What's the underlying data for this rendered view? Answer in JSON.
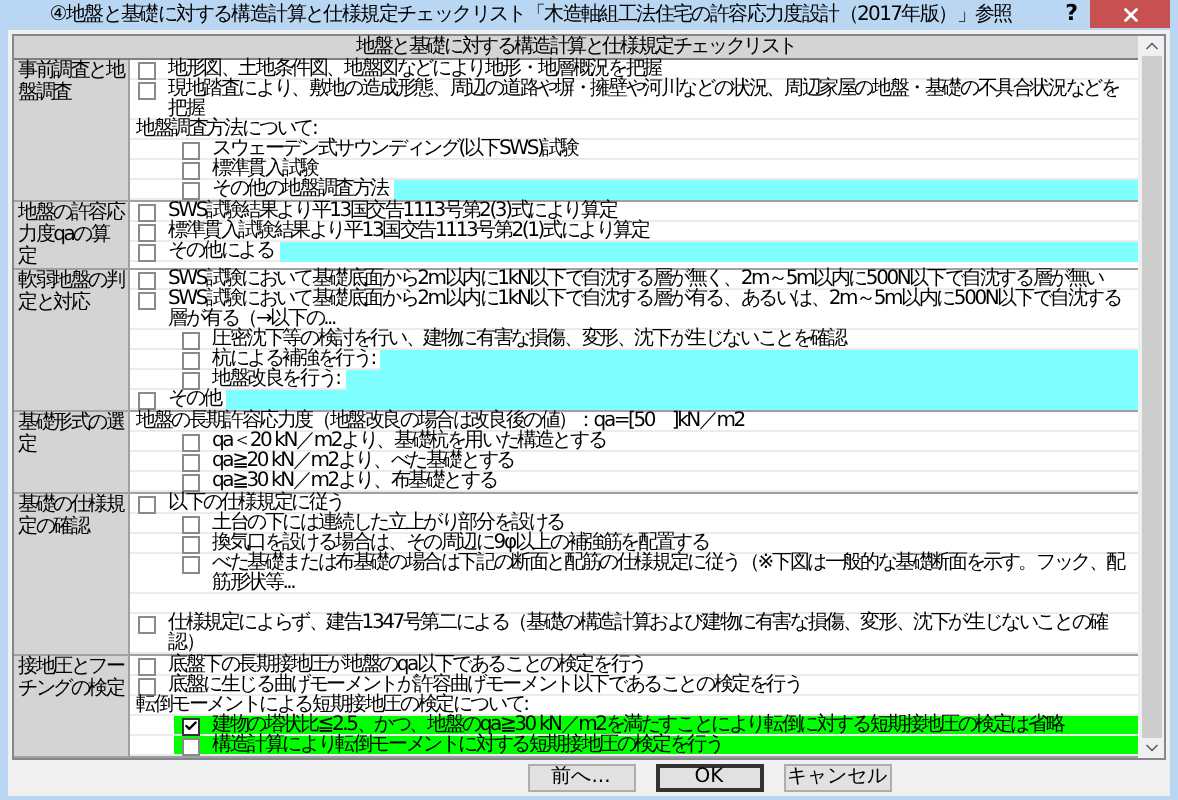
{
  "window": {
    "title": "④地盤と基礎に対する構造計算と仕様規定チェックリスト「木造軸組工法住宅の許容応力度設計（2017年版）」参照",
    "help": "?"
  },
  "checklist": {
    "heading": "地盤と基礎に対する構造計算と仕様規定チェックリスト",
    "sections": [
      {
        "label": "事前調査と地盤調査",
        "items": [
          {
            "kind": "check",
            "text": "地形図、土地条件図、地盤図などにより地形・地層概況を把握",
            "checked": false
          },
          {
            "kind": "check",
            "text": "現地踏査により、敷地の造成形態、周辺の道路や塀・擁壁や河川などの状況、周辺家屋の地盤・基礎の不具合状況などを把握",
            "checked": false
          },
          {
            "kind": "label",
            "text": "地盤調査方法について:",
            "children": [
              {
                "kind": "check",
                "text": "スウェーデン式サウンディング(以下SWS)試験",
                "checked": false,
                "highlighted": false
              },
              {
                "kind": "check",
                "text": "標準貫入試験",
                "checked": false,
                "highlighted": false
              },
              {
                "kind": "check_input",
                "text": "その他の地盤調査方法",
                "checked": false,
                "highlighted": false
              }
            ]
          }
        ]
      },
      {
        "label": "地盤の許容応力度qaの算定",
        "items": [
          {
            "kind": "check",
            "text": "SWS試験結果より平13国交告1113号第2(3)式により算定",
            "checked": false
          },
          {
            "kind": "check",
            "text": "標準貫入試験結果より平13国交告1113号第2(1)式により算定",
            "checked": false
          },
          {
            "kind": "check_input",
            "text": "その他による",
            "checked": false
          }
        ]
      },
      {
        "label": "軟弱地盤の判定と対応",
        "items": [
          {
            "kind": "check",
            "text": "SWS試験において基礎底面から2m以内に1kN以下で自沈する層が無く、2m～5m以内に500N以下で自沈する層が無い",
            "checked": false
          },
          {
            "kind": "check",
            "text": "SWS試験において基礎底面から2m以内に1kN以下で自沈する層が有る、あるいは、2m～5m以内に500N以下で自沈する層が有る（→以下の...",
            "checked": false,
            "children": [
              {
                "kind": "check",
                "text": "圧密沈下等の検討を行い、建物に有害な損傷、変形、沈下が生じないことを確認",
                "checked": false,
                "highlighted": false
              },
              {
                "kind": "check_input",
                "text": "杭による補強を行う:",
                "checked": false,
                "highlighted": false
              },
              {
                "kind": "check_input",
                "text": "地盤改良を行う:",
                "checked": false,
                "highlighted": false
              }
            ]
          },
          {
            "kind": "check_input",
            "text": "その他",
            "checked": false
          }
        ]
      },
      {
        "label": "基礎形式の選定",
        "items": [
          {
            "kind": "label",
            "text": "地盤の長期許容応力度（地盤改良の場合は改良後の値）：qa=[50　]kN／m2",
            "children": [
              {
                "kind": "check",
                "text": "qa＜20 kN／m2より、基礎杭を用いた構造とする",
                "checked": false,
                "highlighted": false
              },
              {
                "kind": "check",
                "text": "qa≧20 kN／m2より、べた基礎とする",
                "checked": false,
                "highlighted": false
              },
              {
                "kind": "check",
                "text": "qa≧30 kN／m2より、布基礎とする",
                "checked": false,
                "highlighted": false
              }
            ]
          }
        ]
      },
      {
        "label": "基礎の仕様規定の確認",
        "items": [
          {
            "kind": "check",
            "text": "以下の仕様規定に従う",
            "checked": false,
            "children": [
              {
                "kind": "check",
                "text": "土台の下には連続した立上がり部分を設ける",
                "checked": false,
                "highlighted": false
              },
              {
                "kind": "check",
                "text": "換気口を設ける場合は、その周辺に9φ以上の補強筋を配置する",
                "checked": false,
                "highlighted": false
              },
              {
                "kind": "check",
                "text": "べた基礎または布基礎の場合は下記の断面と配筋の仕様規定に従う（※下図は一般的な基礎断面を示す。フック、配筋形状等...",
                "checked": false,
                "highlighted": false
              },
              {
                "kind": "blank"
              }
            ]
          },
          {
            "kind": "check",
            "text": "仕様規定によらず、建告1347号第二による（基礎の構造計算および建物に有害な損傷、変形、沈下が生じないことの確認）",
            "checked": false
          }
        ]
      },
      {
        "label": "接地圧とフーチングの検定",
        "items": [
          {
            "kind": "check",
            "text": "底盤下の長期接地圧が地盤のqa以下であることの検定を行う",
            "checked": false
          },
          {
            "kind": "check",
            "text": "底盤に生じる曲げモーメントが許容曲げモーメント以下であることの検定を行う",
            "checked": false
          },
          {
            "kind": "label",
            "text": "転倒モーメントによる短期接地圧の検定について:",
            "children": [
              {
                "kind": "check",
                "text": "建物の塔状比≦2.5、かつ、地盤のqa≧30 kN／m2を満たすことにより転倒に対する短期接地圧の検定は省略",
                "checked": true,
                "highlighted": true
              },
              {
                "kind": "check",
                "text": "構造計算により転倒モーメントに対する短期接地圧の検定を行う",
                "checked": false,
                "highlighted": true
              }
            ]
          }
        ]
      }
    ]
  },
  "buttons": [
    {
      "label": "前へ...",
      "default": false
    },
    {
      "label": "OK",
      "default": true
    },
    {
      "label": "キャンセル",
      "default": false
    }
  ]
}
